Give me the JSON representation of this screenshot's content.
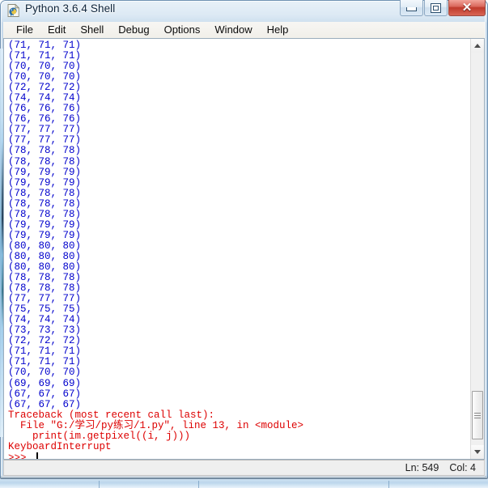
{
  "window": {
    "title": "Python 3.6.4 Shell",
    "icon": "python-idle-icon",
    "controls": {
      "minimize": "minimize-button",
      "maximize": "maximize-button",
      "close_glyph": "✕"
    }
  },
  "menubar": {
    "items": [
      {
        "label": "File"
      },
      {
        "label": "Edit"
      },
      {
        "label": "Shell"
      },
      {
        "label": "Debug"
      },
      {
        "label": "Options"
      },
      {
        "label": "Window"
      },
      {
        "label": "Help"
      }
    ]
  },
  "shell": {
    "output_lines": [
      {
        "text": "(71, 71, 71)",
        "kind": "output"
      },
      {
        "text": "(71, 71, 71)",
        "kind": "output"
      },
      {
        "text": "(70, 70, 70)",
        "kind": "output"
      },
      {
        "text": "(70, 70, 70)",
        "kind": "output"
      },
      {
        "text": "(72, 72, 72)",
        "kind": "output"
      },
      {
        "text": "(74, 74, 74)",
        "kind": "output"
      },
      {
        "text": "(76, 76, 76)",
        "kind": "output"
      },
      {
        "text": "(76, 76, 76)",
        "kind": "output"
      },
      {
        "text": "(77, 77, 77)",
        "kind": "output"
      },
      {
        "text": "(77, 77, 77)",
        "kind": "output"
      },
      {
        "text": "(78, 78, 78)",
        "kind": "output"
      },
      {
        "text": "(78, 78, 78)",
        "kind": "output"
      },
      {
        "text": "(79, 79, 79)",
        "kind": "output"
      },
      {
        "text": "(79, 79, 79)",
        "kind": "output"
      },
      {
        "text": "(78, 78, 78)",
        "kind": "output"
      },
      {
        "text": "(78, 78, 78)",
        "kind": "output"
      },
      {
        "text": "(78, 78, 78)",
        "kind": "output"
      },
      {
        "text": "(79, 79, 79)",
        "kind": "output"
      },
      {
        "text": "(79, 79, 79)",
        "kind": "output"
      },
      {
        "text": "(80, 80, 80)",
        "kind": "output"
      },
      {
        "text": "(80, 80, 80)",
        "kind": "output"
      },
      {
        "text": "(80, 80, 80)",
        "kind": "output"
      },
      {
        "text": "(78, 78, 78)",
        "kind": "output"
      },
      {
        "text": "(78, 78, 78)",
        "kind": "output"
      },
      {
        "text": "(77, 77, 77)",
        "kind": "output"
      },
      {
        "text": "(75, 75, 75)",
        "kind": "output"
      },
      {
        "text": "(74, 74, 74)",
        "kind": "output"
      },
      {
        "text": "(73, 73, 73)",
        "kind": "output"
      },
      {
        "text": "(72, 72, 72)",
        "kind": "output"
      },
      {
        "text": "(71, 71, 71)",
        "kind": "output"
      },
      {
        "text": "(71, 71, 71)",
        "kind": "output"
      },
      {
        "text": "(70, 70, 70)",
        "kind": "output"
      },
      {
        "text": "(69, 69, 69)",
        "kind": "output"
      },
      {
        "text": "(67, 67, 67)",
        "kind": "output"
      },
      {
        "text": "(67, 67, 67)",
        "kind": "output"
      },
      {
        "text": "Traceback (most recent call last):",
        "kind": "error"
      },
      {
        "text": "  File \"G:/学习/py练习/1.py\", line 13, in <module>",
        "kind": "error"
      },
      {
        "text": "    print(im.getpixel((i, j)))",
        "kind": "error"
      },
      {
        "text": "KeyboardInterrupt",
        "kind": "error"
      }
    ],
    "prompt": ">>> "
  },
  "statusbar": {
    "line_label": "Ln: 549",
    "col_label": "Col: 4"
  },
  "colors": {
    "output_text": "#0000cc",
    "error_text": "#dd0000",
    "titlebar_text": "#0b2239",
    "close_button": "#bf3a2c"
  }
}
